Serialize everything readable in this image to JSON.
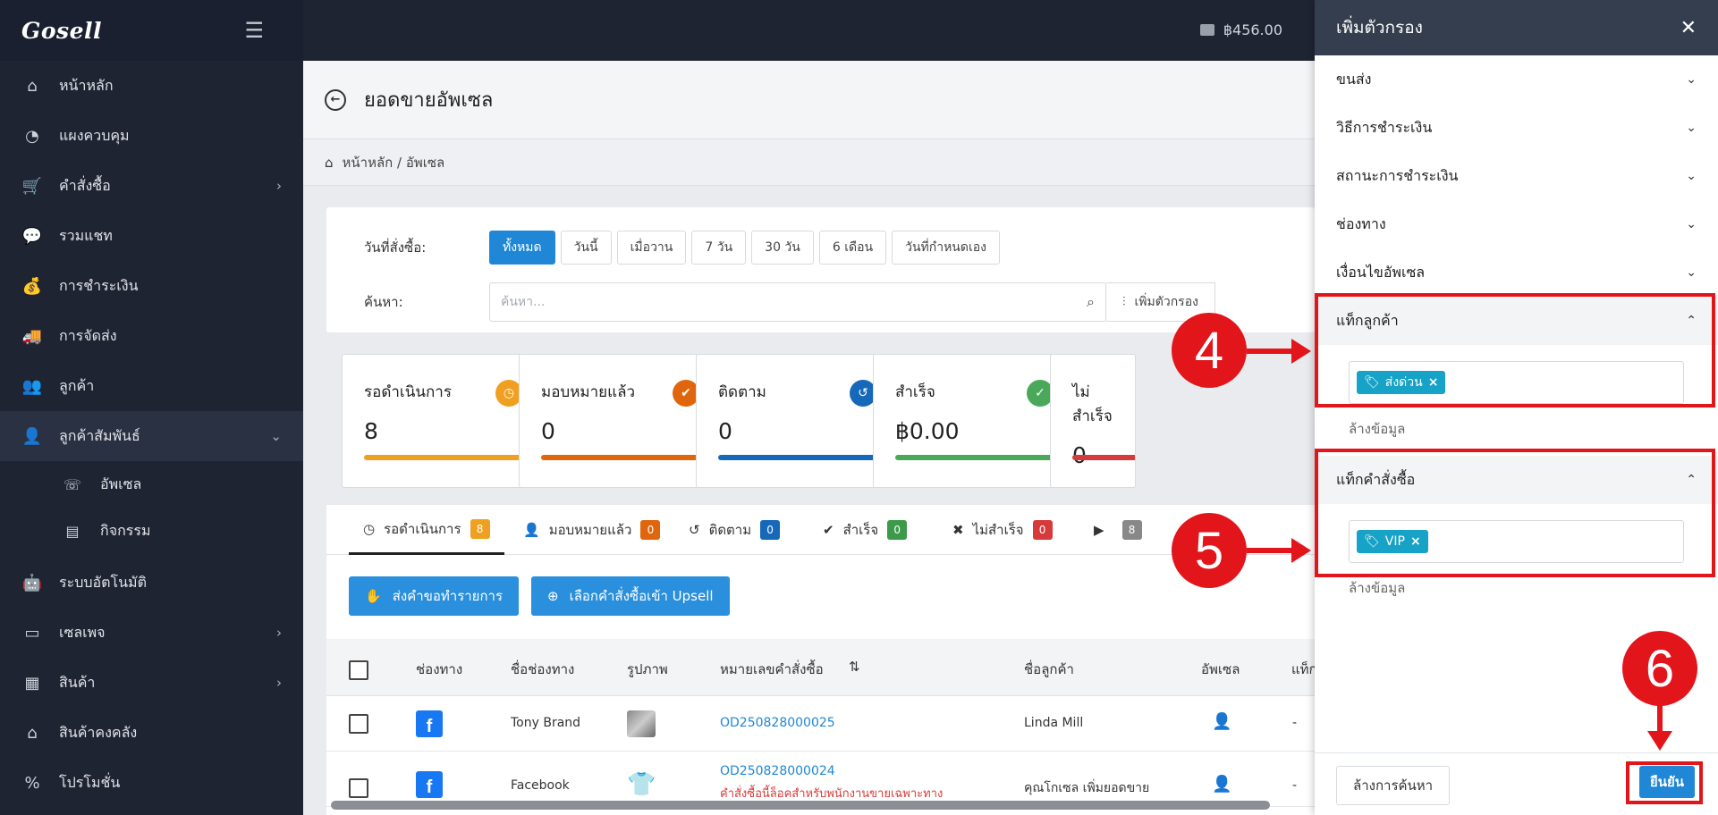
{
  "app": {
    "logo": "Gosell"
  },
  "sidebar": {
    "items": [
      {
        "label": "หน้าหลัก",
        "icon": "home-icon",
        "glyph": "⌂"
      },
      {
        "label": "แผงควบคุม",
        "icon": "dashboard-icon",
        "glyph": "◔"
      },
      {
        "label": "คำสั่งซื้อ",
        "icon": "cart-icon",
        "glyph": "🛒",
        "chevron": "›"
      },
      {
        "label": "รวมแชท",
        "icon": "chat-icon",
        "glyph": "💬"
      },
      {
        "label": "การชำระเงิน",
        "icon": "money-bag-icon",
        "glyph": "💰"
      },
      {
        "label": "การจัดส่ง",
        "icon": "truck-icon",
        "glyph": "🚚"
      },
      {
        "label": "ลูกค้า",
        "icon": "users-icon",
        "glyph": "👥"
      },
      {
        "label": "ลูกค้าสัมพันธ์",
        "icon": "user-tie-icon",
        "glyph": "👤",
        "chevron": "⌄"
      }
    ],
    "sub_items": [
      {
        "label": "อัพเซล",
        "icon": "phone-volume-icon",
        "glyph": "☏"
      },
      {
        "label": "กิจกรรม",
        "icon": "list-icon",
        "glyph": "▤"
      }
    ],
    "items_bottom": [
      {
        "label": "ระบบอัตโนมัติ",
        "icon": "robot-icon",
        "glyph": "🤖"
      },
      {
        "label": "เซลเพจ",
        "icon": "window-icon",
        "glyph": "▭",
        "chevron": "›"
      },
      {
        "label": "สินค้า",
        "icon": "boxes-icon",
        "glyph": "▦",
        "chevron": "›"
      },
      {
        "label": "สินค้าคงคลัง",
        "icon": "warehouse-icon",
        "glyph": "⌂"
      },
      {
        "label": "โปรโมชั่น",
        "icon": "percent-icon",
        "glyph": "%"
      }
    ]
  },
  "topbar": {
    "balance": "฿456.00"
  },
  "page": {
    "title": "ยอดขายอัพเซล",
    "breadcrumb": "หน้าหลัก / อัพเซล"
  },
  "filters": {
    "date_label": "วันที่สั่งซื้อ:",
    "date_options": [
      "ทั้งหมด",
      "วันนี้",
      "เมื่อวาน",
      "7 วัน",
      "30 วัน",
      "6 เดือน",
      "วันที่กำหนดเอง"
    ],
    "date_selected": "ทั้งหมด",
    "search_label": "ค้นหา:",
    "search_placeholder": "ค้นหา...",
    "add_filter_label": "เพิ่มตัวกรอง"
  },
  "stats": [
    {
      "title": "รอดำเนินการ",
      "value": "8",
      "color": "#f0a020",
      "glyph": "◷"
    },
    {
      "title": "มอบหมายแล้ว",
      "value": "0",
      "color": "#e0660d",
      "glyph": "✔"
    },
    {
      "title": "ติดตาม",
      "value": "0",
      "color": "#1668b8",
      "glyph": "↺"
    },
    {
      "title": "สำเร็จ",
      "value": "฿0.00",
      "color": "#4aa85a",
      "glyph": "✓"
    },
    {
      "title": "ไม่สำเร็จ",
      "value": "0",
      "color": "#d63a3a",
      "glyph": "✕"
    }
  ],
  "tabs": [
    {
      "label": "รอดำเนินการ",
      "count": "8",
      "color": "#f0a020",
      "glyph": "◷"
    },
    {
      "label": "มอบหมายแล้ว",
      "count": "0",
      "color": "#e0660d",
      "glyph": "👤"
    },
    {
      "label": "ติดตาม",
      "count": "0",
      "color": "#1668b8",
      "glyph": "↺"
    },
    {
      "label": "สำเร็จ",
      "count": "0",
      "color": "#3c9a4a",
      "glyph": "✔"
    },
    {
      "label": "ไม่สำเร็จ",
      "count": "0",
      "color": "#d63a3a",
      "glyph": "✖"
    },
    {
      "label": "",
      "count": "8",
      "color": "#888888",
      "glyph": "▶"
    }
  ],
  "actions": {
    "send_request": "ส่งคำขอทำรายการ",
    "select_orders": "เลือกคำสั่งซื้อเข้า Upsell"
  },
  "table": {
    "headers": [
      "ช่องทาง",
      "ชื่อช่องทาง",
      "รูปภาพ",
      "หมายเลขคำสั่งซื้อ",
      "ชื่อลูกค้า",
      "อัพเซล",
      "แท็ก"
    ],
    "sort_glyph": "⇅",
    "rows": [
      {
        "channel_name": "Tony Brand",
        "order_no": "OD250828000025",
        "customer": "Linda Mill",
        "tag": "-",
        "note": ""
      },
      {
        "channel_name": "Facebook",
        "order_no": "OD250828000024",
        "customer": "คุณโกเซล เพิ่มยอดขาย",
        "tag": "-",
        "note": "คำสั่งซื้อนี้ล็อคสำหรับพนักงานขายเฉพาะทาง"
      }
    ]
  },
  "panel": {
    "title": "เพิ่มตัวกรอง",
    "close_glyph": "✕",
    "sections": [
      "ขนส่ง",
      "วิธีการชำระเงิน",
      "สถานะการชำระเงิน",
      "ช่องทาง",
      "เงื่อนไขอัพเซล"
    ],
    "customer_tag": {
      "label": "แท็กลูกค้า",
      "tag": "ส่งด่วน",
      "clear": "ล้างข้อมูล"
    },
    "order_tag": {
      "label": "แท็กคำสั่งซื้อ",
      "tag": "VIP",
      "clear": "ล้างข้อมูล"
    },
    "clear_search": "ล้างการค้นหา",
    "confirm": "ยืนยัน"
  },
  "annotations": {
    "step4": "4",
    "step5": "5",
    "step6": "6"
  }
}
